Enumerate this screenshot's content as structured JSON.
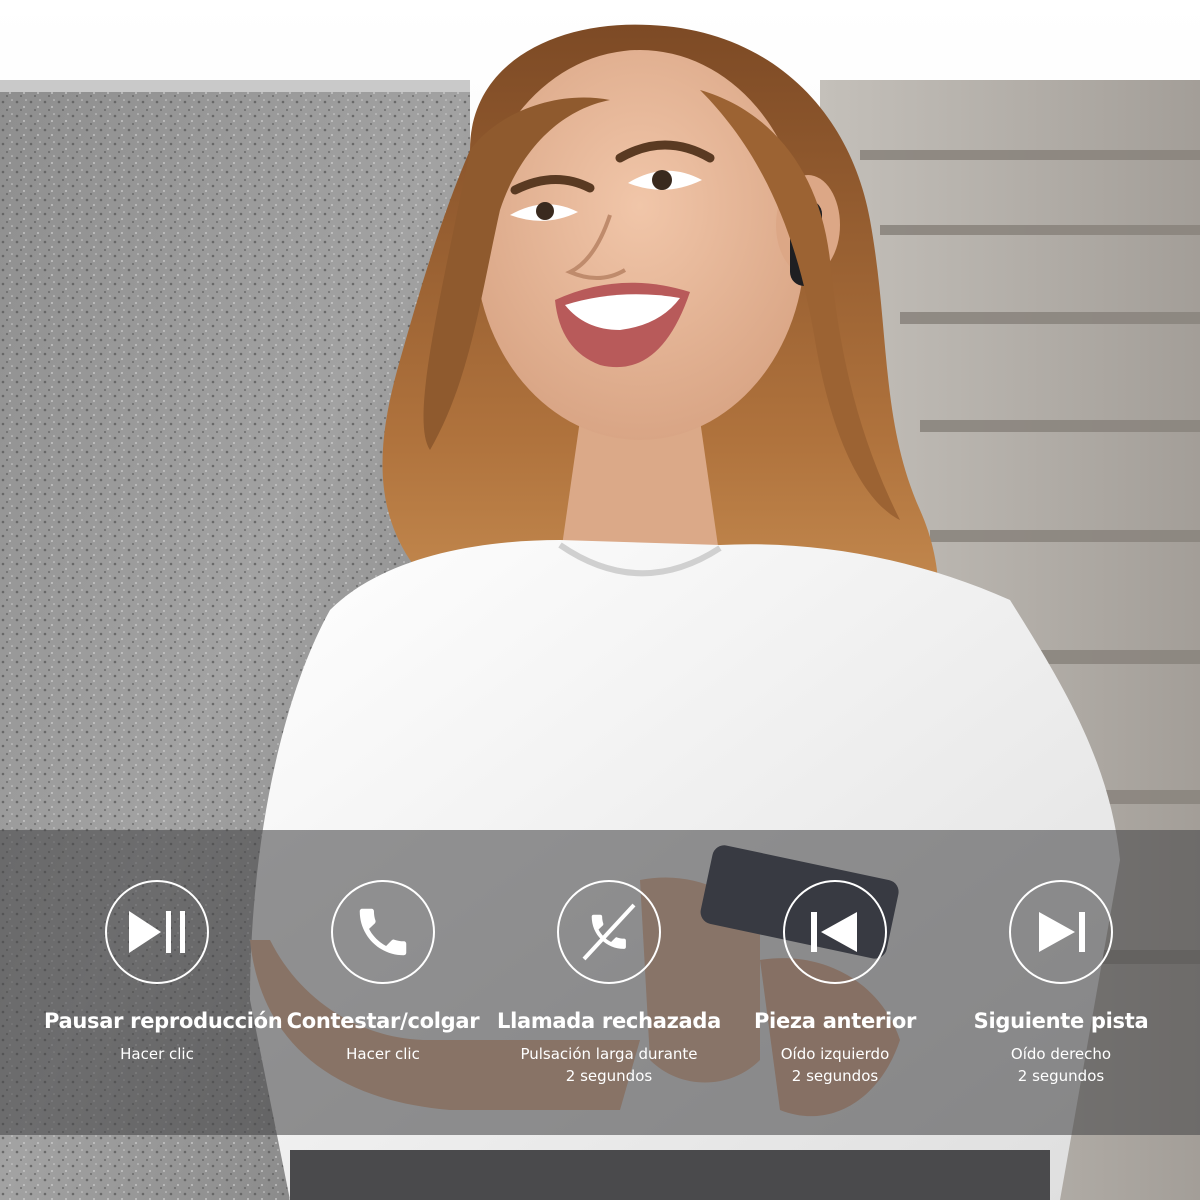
{
  "controls": [
    {
      "icon": "play-pause-icon",
      "title": "Pausar reproducción",
      "subtitle": "Hacer clic"
    },
    {
      "icon": "phone-icon",
      "title": "Contestar/colgar",
      "subtitle": "Hacer clic"
    },
    {
      "icon": "phone-rejected-icon",
      "title": "Llamada rechazada",
      "subtitle": "Pulsación larga durante\n2 segundos"
    },
    {
      "icon": "previous-track-icon",
      "title": "Pieza anterior",
      "subtitle": "Oído izquierdo\n2 segundos"
    },
    {
      "icon": "next-track-icon",
      "title": "Siguiente pista",
      "subtitle": "Oído derecho\n2 segundos"
    }
  ],
  "colors": {
    "band": "#464648",
    "text": "#ffffff",
    "shirt": "#f4f4f4",
    "hair": "#a0612c"
  }
}
